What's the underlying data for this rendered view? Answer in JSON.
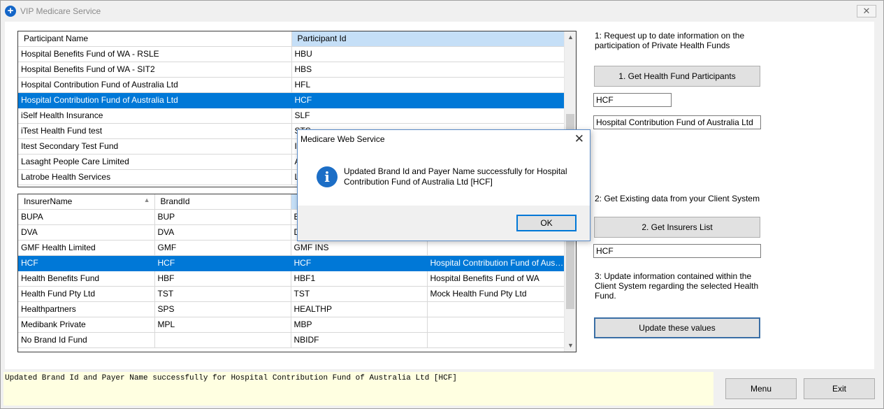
{
  "window": {
    "title": "VIP Medicare Service",
    "close_glyph": "✕"
  },
  "participants_grid": {
    "columns": [
      "Participant Name",
      "Participant Id"
    ],
    "rows": [
      [
        "Hospital Benefits Fund of WA - RSLE",
        "HBU"
      ],
      [
        "Hospital Benefits Fund of WA - SIT2",
        "HBS"
      ],
      [
        "Hospital Contribution Fund of Australia Ltd",
        "HFL"
      ],
      [
        "Hospital Contribution Fund of Australia Ltd",
        "HCF"
      ],
      [
        "iSelf Health Insurance",
        "SLF"
      ],
      [
        "iTest Health Fund test",
        "STS"
      ],
      [
        "Itest Secondary Test Fund",
        "IT"
      ],
      [
        "Lasaght People Care Limited",
        "A"
      ],
      [
        "Latrobe Health Services",
        "L"
      ]
    ],
    "selected_row": 3
  },
  "insurers_grid": {
    "columns": [
      "InsurerName",
      "BrandId",
      "",
      ""
    ],
    "rows": [
      [
        "BUPA",
        "BUP",
        "B",
        ""
      ],
      [
        "DVA",
        "DVA",
        "D",
        ""
      ],
      [
        "GMF Health Limited",
        "GMF",
        "GMF INS",
        ""
      ],
      [
        "HCF",
        "HCF",
        "HCF",
        "Hospital Contribution Fund of Australi..."
      ],
      [
        "Health Benefits Fund",
        "HBF",
        "HBF1",
        "Hospital Benefits Fund of WA"
      ],
      [
        "Health Fund Pty Ltd",
        "TST",
        "TST",
        "Mock Health Fund Pty Ltd"
      ],
      [
        "Healthpartners",
        "SPS",
        "HEALTHP",
        ""
      ],
      [
        "Medibank Private",
        "MPL",
        "MBP",
        ""
      ],
      [
        "No Brand Id Fund",
        "",
        "NBIDF",
        ""
      ]
    ],
    "selected_row": 3
  },
  "right_panel": {
    "step1_text": "1: Request up to date information on the participation of Private Health Funds",
    "step1_button": "1. Get Health Fund Participants",
    "participant_id_value": "HCF",
    "participant_name_value": "Hospital Contribution Fund of Australia Ltd",
    "step2_text": "2: Get Existing data from your Client System",
    "step2_button": "2. Get Insurers List",
    "insurer_value": "HCF",
    "step3_text": "3: Update information contained within the Client System regarding the selected Health Fund.",
    "step3_button": "Update these values"
  },
  "status_text": "Updated Brand Id and Payer Name successfully for Hospital Contribution Fund of Australia Ltd [HCF]",
  "footer": {
    "menu_button": "Menu",
    "exit_button": "Exit"
  },
  "dialog": {
    "title": "Medicare Web Service",
    "message": "Updated Brand Id and Payer Name successfully for Hospital Contribution Fund of Australia Ltd [HCF]",
    "ok_button": "OK",
    "icon_glyph": "i",
    "close_glyph": "✕"
  },
  "icons": {
    "app_icon": "+",
    "scroll_up": "▲",
    "scroll_down": "▼",
    "sort_up": "▲"
  },
  "colors": {
    "selection": "#0078d7",
    "status_background": "#ffffe1",
    "sorted_header": "#c5dff7"
  }
}
